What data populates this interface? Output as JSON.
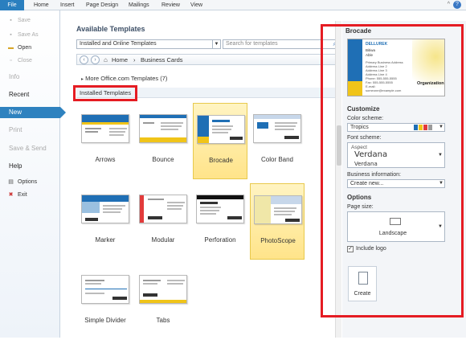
{
  "ribbon": {
    "file_tab": "File",
    "tabs": [
      "Home",
      "Insert",
      "Page Design",
      "Mailings",
      "Review",
      "View"
    ],
    "help": "?",
    "minimize": "^"
  },
  "backstage": {
    "save": "Save",
    "save_as": "Save As",
    "open": "Open",
    "close": "Close",
    "info": "Info",
    "recent": "Recent",
    "new": "New",
    "print": "Print",
    "save_send": "Save & Send",
    "help": "Help",
    "options": "Options",
    "exit": "Exit"
  },
  "main": {
    "title": "Available Templates",
    "filter_value": "Installed and Online Templates",
    "search_placeholder": "Search for templates",
    "nav": {
      "home": "Home",
      "separator": "›",
      "current": "Business Cards"
    },
    "more_link": "More Office.com Templates (7)",
    "section": "Installed Templates",
    "templates": [
      {
        "name": "Arrows"
      },
      {
        "name": "Bounce"
      },
      {
        "name": "Brocade"
      },
      {
        "name": "Color Band"
      },
      {
        "name": "Marker"
      },
      {
        "name": "Modular"
      },
      {
        "name": "Perforation"
      },
      {
        "name": "PhotoScope"
      },
      {
        "name": "Simple Divider"
      },
      {
        "name": "Tabs"
      }
    ]
  },
  "panel": {
    "title": "Brocade",
    "preview": {
      "company": "DELLUREK",
      "name": "Bitiwa",
      "title": "Able",
      "lines": [
        "Primary Business Address",
        "Address Line 2",
        "Address Line 3",
        "Address Line 4",
        "Phone: 555-555-5555",
        "Fax: 555-555-5555",
        "E-mail:",
        "someone@example.com"
      ],
      "org": "Organization"
    },
    "customize": "Customize",
    "color_scheme_label": "Color scheme:",
    "color_scheme_value": "Tropics",
    "swatches": [
      "#1f6fb5",
      "#f0c419",
      "#e23b3b",
      "#9b9b9b"
    ],
    "font_scheme_label": "Font scheme:",
    "font_scheme": {
      "name": "Aspect",
      "heading": "Verdana",
      "body": "Verdana"
    },
    "business_info_label": "Business information:",
    "business_info_value": "Create new...",
    "options": "Options",
    "page_size_label": "Page size:",
    "page_size_value": "Landscape",
    "include_logo": "Include logo",
    "create": "Create"
  }
}
